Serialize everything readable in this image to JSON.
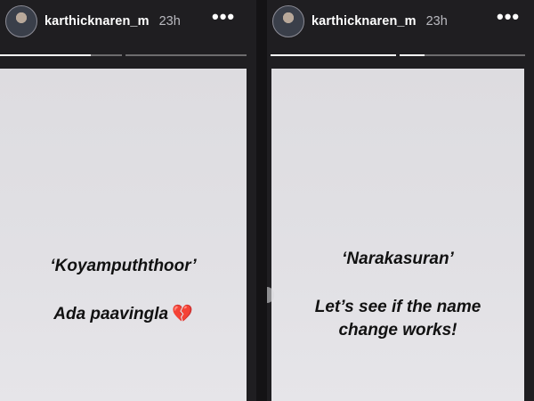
{
  "stories": [
    {
      "username": "karthicknaren_m",
      "time": "23h",
      "more_icon": "more-horizontal-icon",
      "progress": [
        0.75,
        0
      ],
      "quote": "‘Koyampuththoor’",
      "caption": "Ada paavingla",
      "emoji": "broken-heart-icon"
    },
    {
      "username": "karthicknaren_m",
      "time": "23h",
      "more_icon": "more-horizontal-icon",
      "progress": [
        1,
        0.2
      ],
      "quote": "‘Narakasuran’",
      "caption_line1": "Let’s see if the name",
      "caption_line2": "change works!"
    }
  ],
  "colors": {
    "background": "#1f1e21",
    "card": "#e0dfe3",
    "text": "#111111",
    "heart": "#e0245e"
  }
}
